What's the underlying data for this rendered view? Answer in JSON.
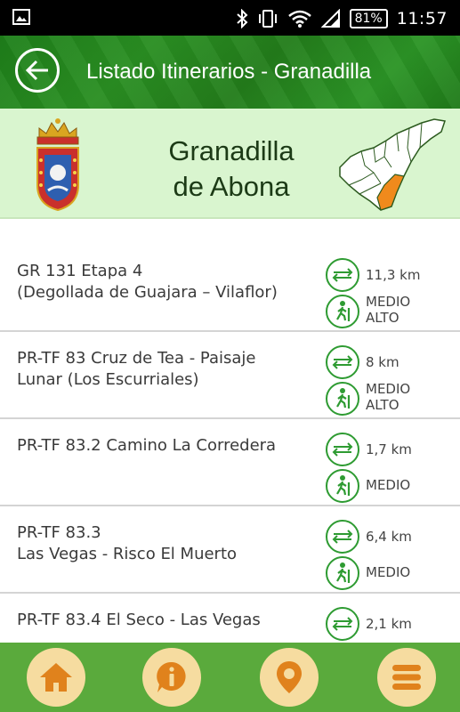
{
  "status_bar": {
    "battery": "81%",
    "time": "11:57",
    "icons": [
      "image-icon",
      "bluetooth-icon",
      "vibrate-icon",
      "wifi-icon",
      "signal-icon",
      "battery-icon"
    ]
  },
  "app_bar": {
    "title": "Listado Itinerarios - Granadilla",
    "back_icon": "back-arrow-icon"
  },
  "banner": {
    "name_line1": "Granadilla",
    "name_line2": "de Abona",
    "crest_icon": "coat-of-arms-icon",
    "map_icon": "island-map-icon",
    "highlight_color": "#f08a1c"
  },
  "routes": [
    {
      "name": "GR 131 Etapa 4\n(Degollada de Guajara – Vilaflor)",
      "distance": "11,3 km",
      "difficulty": "MEDIO\nALTO"
    },
    {
      "name": "PR-TF 83 Cruz de Tea - Paisaje\nLunar (Los Escurriales)",
      "distance": "8 km",
      "difficulty": "MEDIO\nALTO"
    },
    {
      "name": "PR-TF 83.2 Camino La Corredera",
      "distance": "1,7 km",
      "difficulty": "MEDIO"
    },
    {
      "name": "PR-TF 83.3\nLas Vegas - Risco El Muerto",
      "distance": "6,4 km",
      "difficulty": "MEDIO"
    },
    {
      "name": "PR-TF 83.4  El Seco - Las Vegas",
      "distance": "2,1 km",
      "difficulty": ""
    }
  ],
  "bottom_nav": [
    {
      "icon": "home-icon"
    },
    {
      "icon": "info-icon"
    },
    {
      "icon": "map-pin-icon"
    },
    {
      "icon": "menu-list-icon"
    }
  ],
  "colors": {
    "app_bar": "#237d1b",
    "banner": "#d9f5cf",
    "icon_green": "#2e9b32",
    "bottom_bar": "#5aaa3c",
    "nav_button": "#f6dca0",
    "nav_icon": "#e0821c"
  }
}
